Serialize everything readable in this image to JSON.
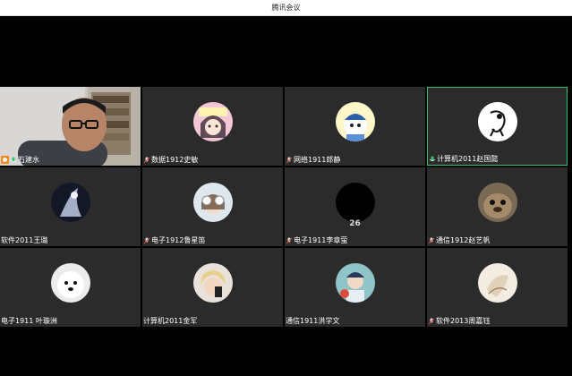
{
  "window": {
    "title": "腾讯会议"
  },
  "participants": [
    {
      "name": "石建水",
      "icon": "host-badge-icon",
      "mic": "mic-on-icon"
    },
    {
      "name": "数据1912史敏",
      "mic": "mic-muted-icon"
    },
    {
      "name": "网络1911郎静",
      "mic": "mic-muted-icon"
    },
    {
      "name": "计算机2011赵国懿",
      "mic": "mic-on-icon",
      "active": true
    },
    {
      "name": "软件2011王璐",
      "mic": "none"
    },
    {
      "name": "电子1912鲁星笛",
      "mic": "mic-muted-icon"
    },
    {
      "name": "电子1911李章萤",
      "mic": "mic-muted-icon",
      "overlay": "26"
    },
    {
      "name": "通信1912赵艺帆",
      "mic": "mic-muted-icon"
    },
    {
      "name": "电子1911 叶璇洲",
      "mic": "none"
    },
    {
      "name": "计算机2011金军",
      "mic": "none"
    },
    {
      "name": "通信1911洪学文",
      "mic": "none"
    },
    {
      "name": "软件2013周嘉钰",
      "mic": "mic-muted-icon"
    }
  ],
  "colors": {
    "tile_bg": "#2b2b2b",
    "active_border": "#2ec76f",
    "host_badge": "#f28b1f",
    "mic_on": "#2ec76f"
  }
}
